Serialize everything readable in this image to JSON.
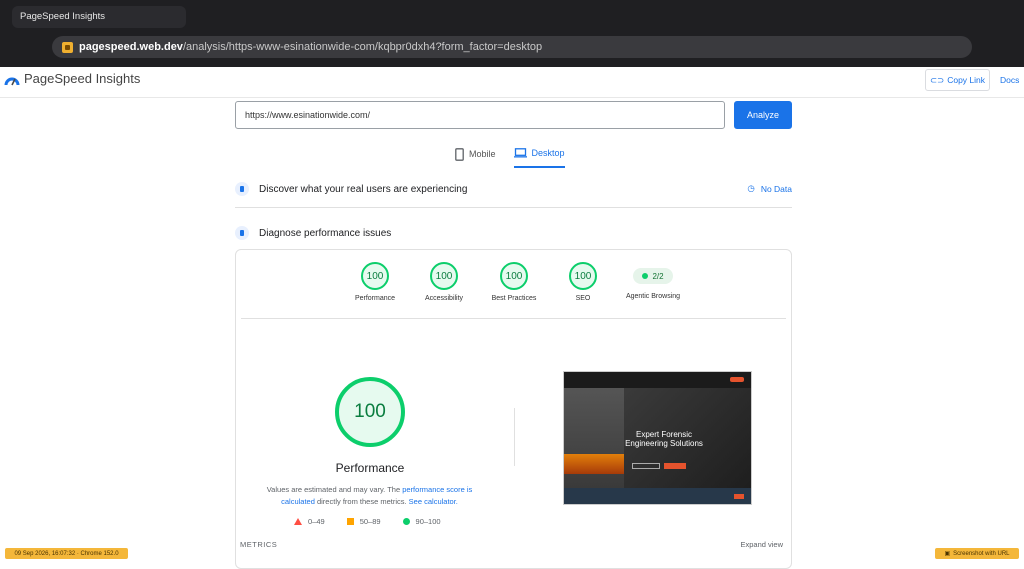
{
  "browser": {
    "tab_title": "PageSpeed Insights",
    "url_host": "pagespeed.web.dev",
    "url_path": "/analysis/https-www-esinationwide-com/kqbpr0dxh4?form_factor=desktop"
  },
  "header": {
    "brand": "PageSpeed Insights",
    "copy_link": "Copy Link",
    "docs": "Docs"
  },
  "search": {
    "url_value": "https://www.esinationwide.com/",
    "analyze_label": "Analyze"
  },
  "tabs": [
    {
      "label": "Mobile",
      "active": false
    },
    {
      "label": "Desktop",
      "active": true
    }
  ],
  "sections": {
    "real_users": "Discover what your real users are experiencing",
    "no_data": "No Data",
    "diagnose": "Diagnose performance issues"
  },
  "scores": [
    {
      "label": "Performance",
      "value": "100"
    },
    {
      "label": "Accessibility",
      "value": "100"
    },
    {
      "label": "Best Practices",
      "value": "100"
    },
    {
      "label": "SEO",
      "value": "100"
    },
    {
      "label": "Agentic Browsing",
      "value": "2/2"
    }
  ],
  "performance": {
    "score": "100",
    "title": "Performance",
    "note_part1": "Values are estimated and may vary. The ",
    "note_link1": "performance score is calculated",
    "note_part2": " directly from these metrics. ",
    "note_link2": "See calculator.",
    "legend": [
      {
        "range": "0–49",
        "color": "#ff4e42"
      },
      {
        "range": "50–89",
        "color": "#ffa400"
      },
      {
        "range": "90–100",
        "color": "#0cce6b"
      }
    ]
  },
  "screenshot": {
    "headline": "Expert Forensic Engineering Solutions"
  },
  "metrics": {
    "label": "METRICS",
    "expand": "Expand view"
  },
  "stamps": {
    "left": "09 Sep 2026, 16:07:32 · Chrome 152.0",
    "right": "Screenshot with URL"
  }
}
